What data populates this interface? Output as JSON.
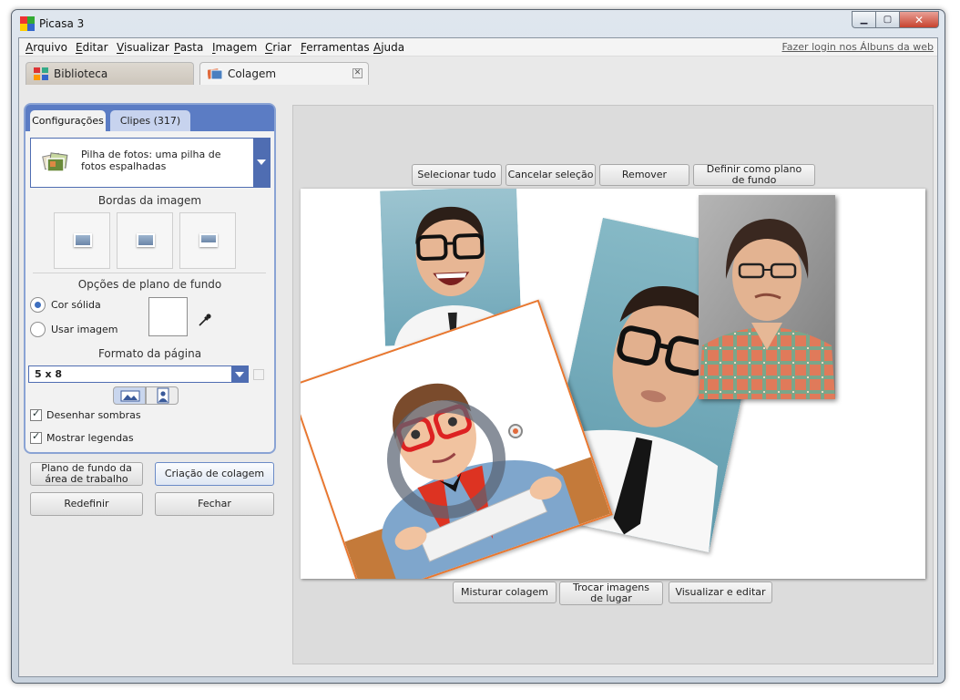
{
  "window": {
    "title": "Picasa 3"
  },
  "menu": {
    "items": [
      "Arquivo",
      "Editar",
      "Visualizar",
      "Pasta",
      "Imagem",
      "Criar",
      "Ferramentas",
      "Ajuda"
    ],
    "login_link": "Fazer login nos Álbuns da web"
  },
  "tabs": {
    "library": "Biblioteca",
    "collage": "Colagem",
    "close_glyph": "✕"
  },
  "panel": {
    "tabs": {
      "settings": "Configurações",
      "clips": "Clipes (317)"
    },
    "collage_type": "Pilha de fotos: uma pilha de fotos espalhadas",
    "borders_title": "Bordas da imagem",
    "background_title": "Opções de plano de fundo",
    "solid_color": "Cor sólida",
    "use_image": "Usar imagem",
    "page_format_title": "Formato da página",
    "page_format_value": "5 x 8",
    "draw_shadows": "Desenhar sombras",
    "show_captions": "Mostrar legendas",
    "selected_background": "solid_color",
    "selected_orientation": "landscape",
    "draw_shadows_checked": true,
    "show_captions_checked": true
  },
  "actions": {
    "desktop_background": "Plano de fundo da área de trabalho",
    "create_collage": "Criação de colagem",
    "reset": "Redefinir",
    "close": "Fechar"
  },
  "toolbar_top": {
    "select_all": "Selecionar tudo",
    "deselect": "Cancelar seleção",
    "remove": "Remover",
    "set_background": "Definir como plano de fundo"
  },
  "toolbar_bottom": {
    "shuffle": "Misturar colagem",
    "swap": "Trocar imagens de lugar",
    "view_edit": "Visualizar e editar"
  },
  "colors": {
    "accent": "#5b7cc4",
    "selection_border": "#e8772f",
    "close_button": "#c7432e"
  }
}
